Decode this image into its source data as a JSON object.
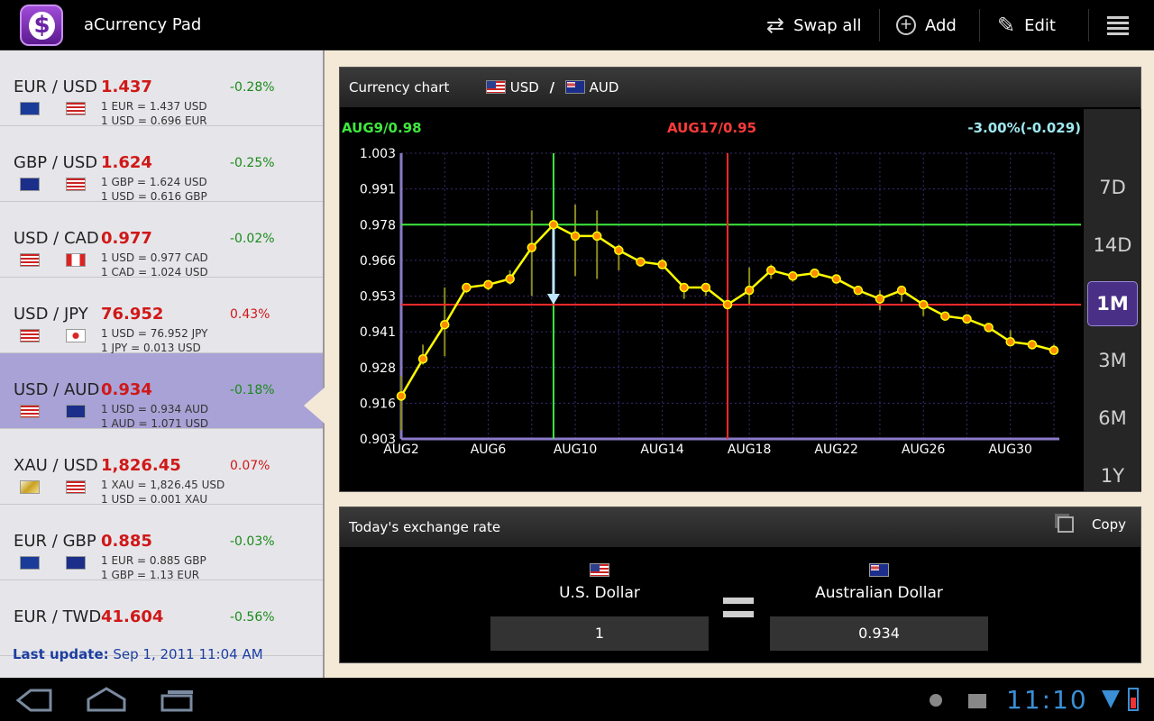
{
  "app": {
    "title": "aCurrency Pad",
    "icon": "dollar-icon"
  },
  "actionbar": {
    "swap_label": "Swap all",
    "add_label": "Add",
    "edit_label": "Edit"
  },
  "pairs": [
    {
      "base": "EUR",
      "quote": "USD",
      "rate": "1.437",
      "change": "-0.28%",
      "dir": "neg",
      "line1": "1 EUR = 1.437 USD",
      "line2": "1 USD = 0.696 EUR"
    },
    {
      "base": "GBP",
      "quote": "USD",
      "rate": "1.624",
      "change": "-0.25%",
      "dir": "neg",
      "line1": "1 GBP = 1.624 USD",
      "line2": "1 USD = 0.616 GBP"
    },
    {
      "base": "USD",
      "quote": "CAD",
      "rate": "0.977",
      "change": "-0.02%",
      "dir": "neg",
      "line1": "1 USD = 0.977 CAD",
      "line2": "1 CAD = 1.024 USD"
    },
    {
      "base": "USD",
      "quote": "JPY",
      "rate": "76.952",
      "change": "0.43%",
      "dir": "pos",
      "line1": "1 USD = 76.952 JPY",
      "line2": "1 JPY = 0.013 USD"
    },
    {
      "base": "USD",
      "quote": "AUD",
      "rate": "0.934",
      "change": "-0.18%",
      "dir": "neg",
      "line1": "1 USD = 0.934 AUD",
      "line2": "1 AUD = 1.071 USD",
      "selected": true
    },
    {
      "base": "XAU",
      "quote": "USD",
      "rate": "1,826.45",
      "change": "0.07%",
      "dir": "pos",
      "line1": "1 XAU = 1,826.45 USD",
      "line2": "1 USD = 0.001 XAU"
    },
    {
      "base": "EUR",
      "quote": "GBP",
      "rate": "0.885",
      "change": "-0.03%",
      "dir": "neg",
      "line1": "1 EUR = 0.885 GBP",
      "line2": "1 GBP = 1.13 EUR"
    },
    {
      "base": "EUR",
      "quote": "TWD",
      "rate": "41.604",
      "change": "-0.56%",
      "dir": "neg",
      "line1": "",
      "line2": ""
    }
  ],
  "last_update": {
    "label": "Last update:",
    "value": "Sep 1, 2011 11:04 AM"
  },
  "chart_panel": {
    "title": "Currency chart",
    "base": "USD",
    "sep": "/",
    "quote": "AUD"
  },
  "periods": [
    "7D",
    "14D",
    "1M",
    "3M",
    "6M",
    "1Y"
  ],
  "active_period": "1M",
  "exchange": {
    "title": "Today's exchange rate",
    "copy_label": "Copy",
    "from_name": "U.S. Dollar",
    "to_name": "Australian Dollar",
    "from_value": "1",
    "to_value": "0.934"
  },
  "system": {
    "clock": "11:10"
  },
  "colors": {
    "accent": "#4a2f86",
    "selected_row": "#a9a2d6",
    "line": "#ffff00",
    "marker_green": "#3ee83e",
    "marker_red": "#ff2a2a"
  },
  "chart_data": {
    "type": "line",
    "x": [
      "AUG2",
      "AUG3",
      "AUG4",
      "AUG5",
      "AUG6",
      "AUG7",
      "AUG8",
      "AUG9",
      "AUG10",
      "AUG11",
      "AUG12",
      "AUG13",
      "AUG14",
      "AUG15",
      "AUG16",
      "AUG17",
      "AUG18",
      "AUG19",
      "AUG20",
      "AUG21",
      "AUG22",
      "AUG23",
      "AUG24",
      "AUG25",
      "AUG26",
      "AUG27",
      "AUG28",
      "AUG29",
      "AUG30",
      "AUG31",
      "SEP1"
    ],
    "series": [
      {
        "values": [
          0.918,
          0.931,
          0.943,
          0.956,
          0.957,
          0.959,
          0.97,
          0.978,
          0.974,
          0.974,
          0.969,
          0.965,
          0.964,
          0.956,
          0.956,
          0.95,
          0.955,
          0.962,
          0.96,
          0.961,
          0.959,
          0.955,
          0.952,
          0.955,
          0.95,
          0.946,
          0.945,
          0.942,
          0.937,
          0.936,
          0.934
        ],
        "lows": [
          0.906,
          0.929,
          0.932,
          0.954,
          0.955,
          0.957,
          0.953,
          0.949,
          0.96,
          0.959,
          0.962,
          0.965,
          0.964,
          0.952,
          0.953,
          0.948,
          0.95,
          0.959,
          0.958,
          0.961,
          0.959,
          0.955,
          0.948,
          0.951,
          0.946,
          0.946,
          0.945,
          0.942,
          0.937,
          0.936,
          0.933
        ],
        "highs": [
          0.925,
          0.936,
          0.956,
          0.957,
          0.957,
          0.962,
          0.983,
          0.979,
          0.985,
          0.983,
          0.971,
          0.966,
          0.966,
          0.956,
          0.956,
          0.958,
          0.963,
          0.964,
          0.961,
          0.962,
          0.959,
          0.956,
          0.955,
          0.956,
          0.951,
          0.946,
          0.946,
          0.943,
          0.941,
          0.937,
          0.936
        ]
      }
    ],
    "ylim": [
      0.903,
      1.003
    ],
    "yticks": [
      "1.003",
      "0.991",
      "0.978",
      "0.966",
      "0.953",
      "0.941",
      "0.928",
      "0.916",
      "0.903"
    ],
    "xticks": [
      "AUG2",
      "AUG6",
      "AUG10",
      "AUG14",
      "AUG18",
      "AUG22",
      "AUG26",
      "AUG30"
    ],
    "markers": {
      "green_label": "AUG9/0.98",
      "green_x": "AUG9",
      "green_y": 0.978,
      "red_label": "AUG17/0.95",
      "red_x": "AUG17",
      "red_y": 0.95,
      "change_label": "-3.00%(-0.029)"
    },
    "grid": true
  }
}
